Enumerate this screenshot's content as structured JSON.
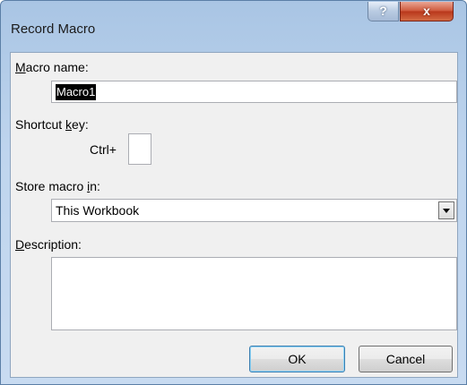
{
  "window": {
    "title": "Record Macro",
    "help_glyph": "?",
    "close_glyph": "x"
  },
  "form": {
    "macro_name": {
      "label_mnemonic": "M",
      "label_rest": "acro name:",
      "value": "Macro1"
    },
    "shortcut_key": {
      "label_before": "Shortcut ",
      "label_mnemonic": "k",
      "label_after": "ey:",
      "prefix": "Ctrl+",
      "value": ""
    },
    "store_macro_in": {
      "label_before": "Store macro ",
      "label_mnemonic": "i",
      "label_after": "n:",
      "selected": "This Workbook"
    },
    "description": {
      "label_mnemonic": "D",
      "label_rest": "escription:",
      "value": ""
    }
  },
  "buttons": {
    "ok": "OK",
    "cancel": "Cancel"
  }
}
